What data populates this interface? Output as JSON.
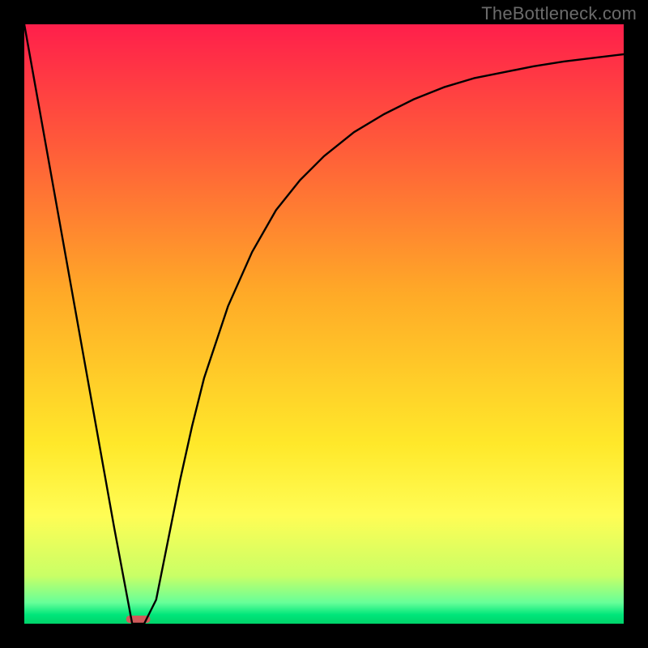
{
  "watermark": "TheBottleneck.com",
  "chart_data": {
    "type": "line",
    "title": "",
    "xlabel": "",
    "ylabel": "",
    "xlim": [
      0,
      100
    ],
    "ylim": [
      0,
      100
    ],
    "grid": false,
    "series": [
      {
        "name": "bottleneck-curve",
        "x": [
          0,
          5,
          10,
          15,
          18,
          20,
          22,
          24,
          26,
          28,
          30,
          34,
          38,
          42,
          46,
          50,
          55,
          60,
          65,
          70,
          75,
          80,
          85,
          90,
          95,
          100
        ],
        "values": [
          100,
          72,
          44,
          16,
          0,
          0,
          4,
          14,
          24,
          33,
          41,
          53,
          62,
          69,
          74,
          78,
          82,
          85,
          87.5,
          89.5,
          91,
          92,
          93,
          93.8,
          94.4,
          95
        ]
      }
    ],
    "optimal_marker": {
      "x_start": 17,
      "x_end": 21,
      "color": "#d05a5a"
    },
    "background_gradient": {
      "stops": [
        {
          "offset": 0.0,
          "color": "#ff1f4b"
        },
        {
          "offset": 0.2,
          "color": "#ff5a3a"
        },
        {
          "offset": 0.45,
          "color": "#ffaa27"
        },
        {
          "offset": 0.7,
          "color": "#ffe82a"
        },
        {
          "offset": 0.82,
          "color": "#fffd55"
        },
        {
          "offset": 0.92,
          "color": "#c9ff66"
        },
        {
          "offset": 0.965,
          "color": "#66ff99"
        },
        {
          "offset": 0.985,
          "color": "#00e67a"
        },
        {
          "offset": 1.0,
          "color": "#00d46a"
        }
      ]
    }
  }
}
